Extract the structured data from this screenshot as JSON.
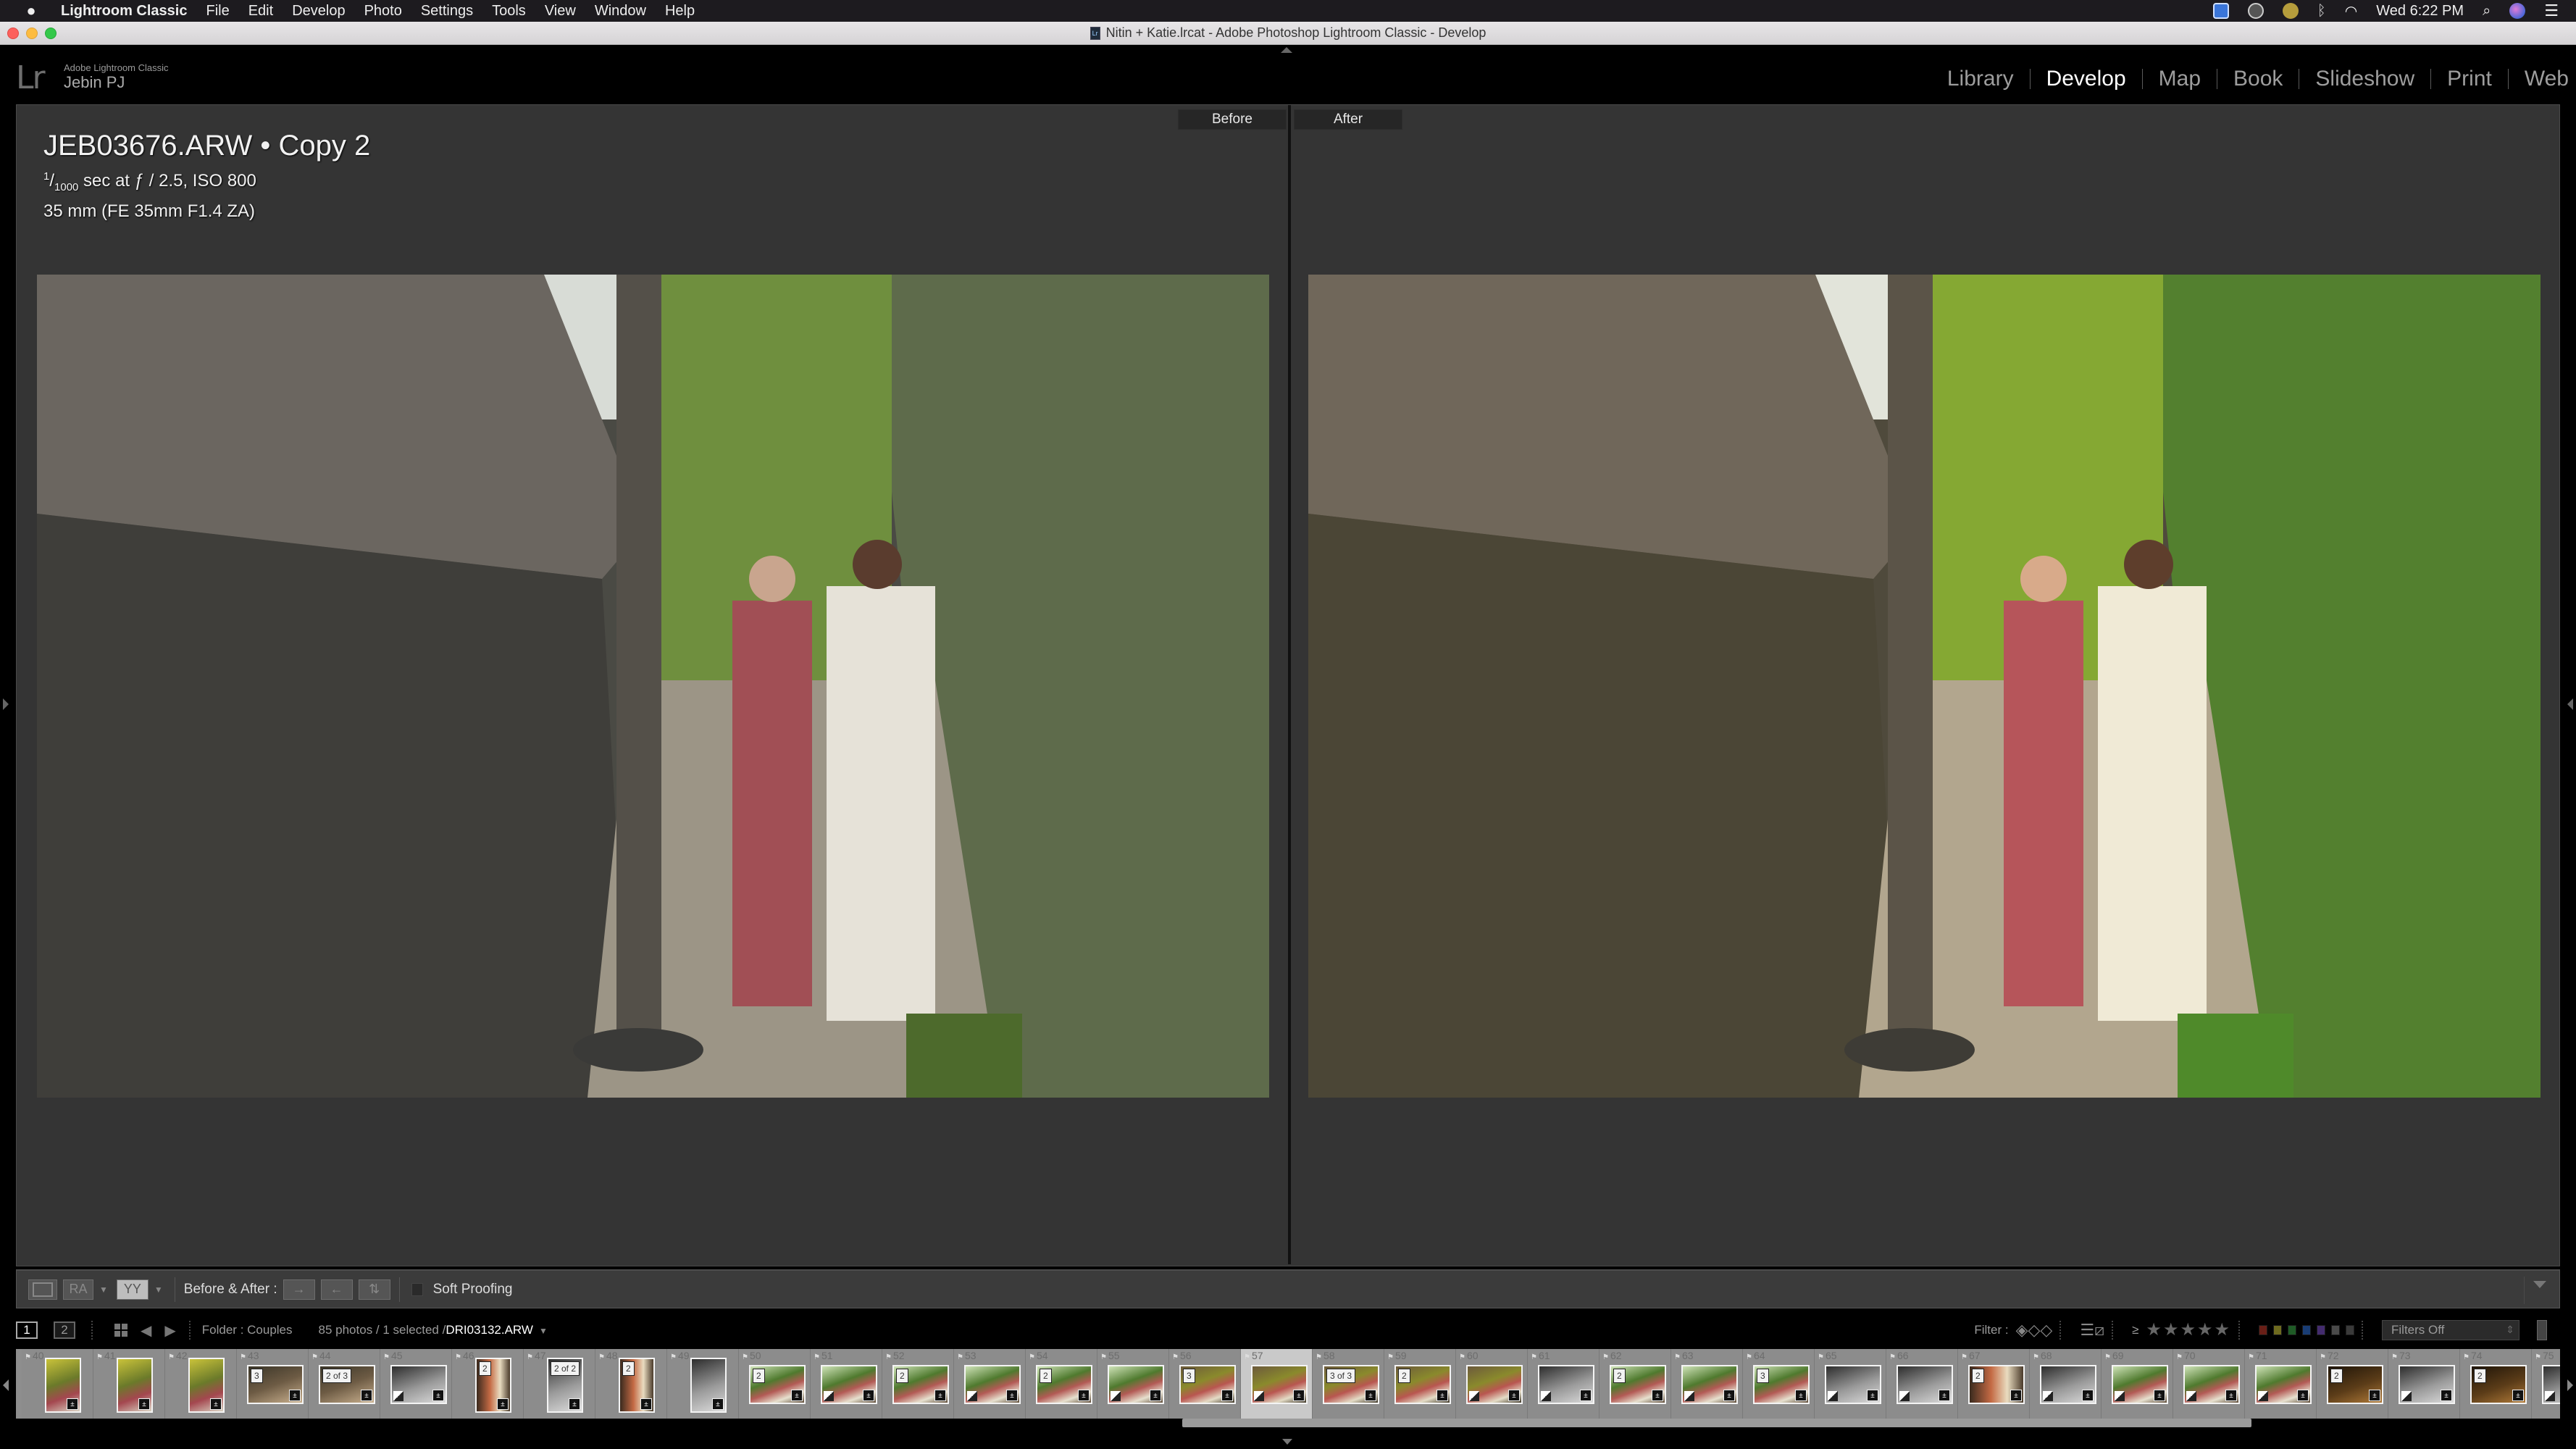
{
  "menubar": {
    "apple": "",
    "app_name": "Lightroom Classic",
    "items": [
      "File",
      "Edit",
      "Develop",
      "Photo",
      "Settings",
      "Tools",
      "View",
      "Window",
      "Help"
    ],
    "status_icons": [
      "teamviewer-icon",
      "creative-cloud-icon",
      "money-icon",
      "bluetooth-icon",
      "wifi-icon"
    ],
    "clock": "Wed 6:22 PM"
  },
  "window": {
    "title": "Nitin + Katie.lrcat - Adobe Photoshop Lightroom Classic - Develop",
    "doc_icon_text": "Lr"
  },
  "identity": {
    "logo": "Lr",
    "product": "Adobe Lightroom Classic",
    "user": "Jebin PJ"
  },
  "modules": {
    "items": [
      "Library",
      "Develop",
      "Map",
      "Book",
      "Slideshow",
      "Print",
      "Web"
    ],
    "active": "Develop"
  },
  "view": {
    "before_label": "Before",
    "after_label": "After",
    "info": {
      "filename": "JEB03676.ARW • Copy 2",
      "shutter_num": "1",
      "shutter_den": "1000",
      "exposure_rest": " sec at ƒ / 2.5, ISO 800",
      "lens": "35 mm (FE 35mm F1.4 ZA)"
    }
  },
  "toolbar": {
    "loupe_label": "",
    "ra_label": "RA",
    "yy_label": "YY",
    "before_after_label": "Before & After :",
    "swap_before_after": "→",
    "copy_after_before": "←",
    "swap_settings": "⇅",
    "soft_proofing_label": "Soft Proofing",
    "soft_proofing_checked": false
  },
  "filmstrip_header": {
    "screen1": "1",
    "screen2": "2",
    "folder": "Folder : Couples",
    "count_prefix": "85 photos / 1 selected /",
    "selected_file": "DRI03132.ARW",
    "filter_label": "Filter :",
    "rating_op": "≥",
    "stars": "★★★★★",
    "filters_preset": "Filters Off",
    "color_labels": [
      "#c0392b",
      "#c8c23a",
      "#3aa745",
      "#2f6fd6",
      "#7b4fc8",
      "#888888",
      "#6a6a6a"
    ]
  },
  "filmstrip": {
    "selected_index": 57,
    "cells": [
      {
        "n": "40",
        "orient": "portrait",
        "badge": "",
        "tone": "yellow"
      },
      {
        "n": "41",
        "orient": "portrait",
        "badge": "",
        "tone": "yellow"
      },
      {
        "n": "42",
        "orient": "portrait",
        "badge": "",
        "tone": "yellow"
      },
      {
        "n": "43",
        "orient": "landscape",
        "badge": "3",
        "tone": "dark"
      },
      {
        "n": "44",
        "orient": "landscape",
        "badge": "2 of 3",
        "tone": "dark"
      },
      {
        "n": "45",
        "orient": "landscape",
        "badge": "",
        "tone": "bw"
      },
      {
        "n": "46",
        "orient": "portrait",
        "badge": "2",
        "tone": "warm"
      },
      {
        "n": "47",
        "orient": "portrait",
        "badge": "2 of 2",
        "tone": "bw"
      },
      {
        "n": "48",
        "orient": "portrait",
        "badge": "2",
        "tone": "warm"
      },
      {
        "n": "49",
        "orient": "portrait",
        "badge": "",
        "tone": "bw"
      },
      {
        "n": "50",
        "orient": "landscape",
        "badge": "2",
        "tone": "green"
      },
      {
        "n": "51",
        "orient": "landscape",
        "badge": "",
        "tone": "green"
      },
      {
        "n": "52",
        "orient": "landscape",
        "badge": "2",
        "tone": "green"
      },
      {
        "n": "53",
        "orient": "landscape",
        "badge": "",
        "tone": "green"
      },
      {
        "n": "54",
        "orient": "landscape",
        "badge": "2",
        "tone": "green"
      },
      {
        "n": "55",
        "orient": "landscape",
        "badge": "",
        "tone": "green"
      },
      {
        "n": "56",
        "orient": "landscape",
        "badge": "3",
        "tone": "olive"
      },
      {
        "n": "57",
        "orient": "landscape",
        "badge": "",
        "tone": "olive"
      },
      {
        "n": "58",
        "orient": "landscape",
        "badge": "3 of 3",
        "tone": "olive"
      },
      {
        "n": "59",
        "orient": "landscape",
        "badge": "2",
        "tone": "olive"
      },
      {
        "n": "60",
        "orient": "landscape",
        "badge": "",
        "tone": "olive"
      },
      {
        "n": "61",
        "orient": "landscape",
        "badge": "",
        "tone": "bw"
      },
      {
        "n": "62",
        "orient": "landscape",
        "badge": "2",
        "tone": "green"
      },
      {
        "n": "63",
        "orient": "landscape",
        "badge": "",
        "tone": "green"
      },
      {
        "n": "64",
        "orient": "landscape",
        "badge": "3",
        "tone": "green"
      },
      {
        "n": "65",
        "orient": "landscape",
        "badge": "",
        "tone": "bw"
      },
      {
        "n": "66",
        "orient": "landscape",
        "badge": "",
        "tone": "bw"
      },
      {
        "n": "67",
        "orient": "landscape",
        "badge": "2",
        "tone": "warm"
      },
      {
        "n": "68",
        "orient": "landscape",
        "badge": "",
        "tone": "bw"
      },
      {
        "n": "69",
        "orient": "landscape",
        "badge": "",
        "tone": "green"
      },
      {
        "n": "70",
        "orient": "landscape",
        "badge": "",
        "tone": "green"
      },
      {
        "n": "71",
        "orient": "landscape",
        "badge": "",
        "tone": "green"
      },
      {
        "n": "72",
        "orient": "landscape",
        "badge": "2",
        "tone": "night"
      },
      {
        "n": "73",
        "orient": "landscape",
        "badge": "",
        "tone": "bw"
      },
      {
        "n": "74",
        "orient": "landscape",
        "badge": "2",
        "tone": "night"
      },
      {
        "n": "75",
        "orient": "landscape",
        "badge": "",
        "tone": "bw"
      }
    ]
  },
  "colors": {
    "accent_active_module": "#ffffff",
    "inactive_module": "#9d9d9d",
    "panel_bg": "#343434",
    "filmstrip_bg": "#8e8e8e",
    "selected_cell": "#c9c9c9"
  }
}
